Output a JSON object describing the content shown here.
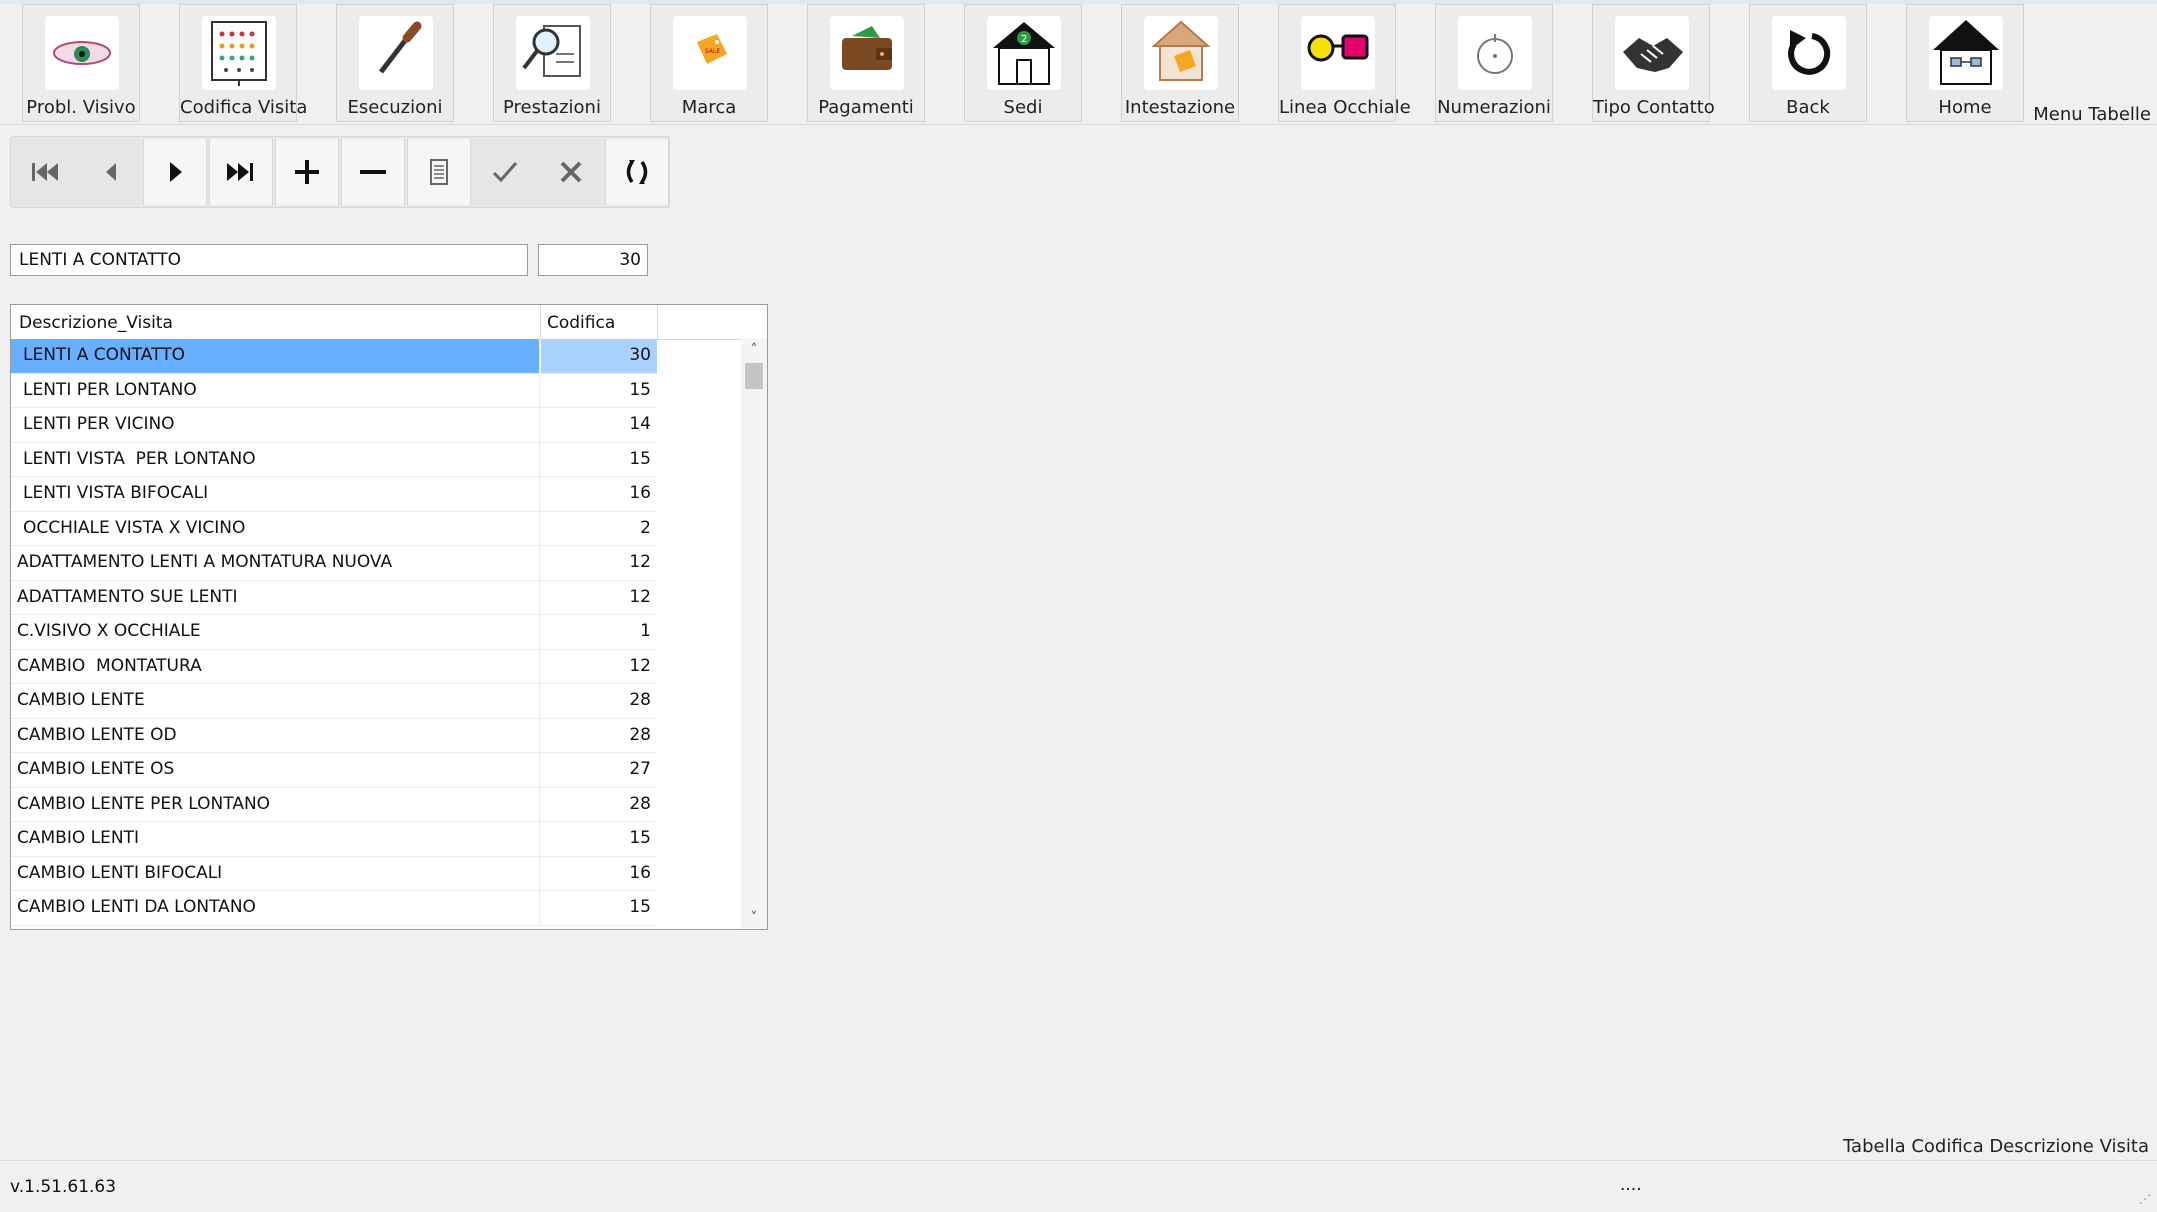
{
  "toolbar": {
    "buttons": [
      {
        "label": "Probl. Visivo",
        "icon": "eye-icon"
      },
      {
        "label": "Codifica Visita",
        "icon": "eye-chart-icon"
      },
      {
        "label": "Esecuzioni",
        "icon": "screwdriver-icon"
      },
      {
        "label": "Prestazioni",
        "icon": "magnifier-document-icon"
      },
      {
        "label": "Marca",
        "icon": "price-tag-icon"
      },
      {
        "label": "Pagamenti",
        "icon": "wallet-icon"
      },
      {
        "label": "Sedi",
        "icon": "house-number-icon"
      },
      {
        "label": "Intestazione",
        "icon": "house-tag-icon"
      },
      {
        "label": "Linea Occhiale",
        "icon": "glasses-icon"
      },
      {
        "label": "Numerazioni",
        "icon": "numbering-icon"
      },
      {
        "label": "Tipo Contatto",
        "icon": "handshake-icon"
      },
      {
        "label": "Back",
        "icon": "back-arrow-icon"
      },
      {
        "label": "Home",
        "icon": "home-icon"
      }
    ],
    "menu_label": "Menu Tabelle"
  },
  "navigator": {
    "buttons": [
      "first-record",
      "previous-record",
      "next-record",
      "last-record",
      "add-record",
      "delete-record",
      "edit-record",
      "confirm",
      "cancel",
      "refresh"
    ]
  },
  "form": {
    "descrizione": "LENTI A CONTATTO",
    "codifica": "30"
  },
  "grid": {
    "columns": [
      "Descrizione_Visita",
      "Codifica"
    ],
    "rows": [
      {
        "desc": "LENTI A CONTATTO",
        "code": "30",
        "selected": true,
        "indent": true
      },
      {
        "desc": "LENTI PER LONTANO",
        "code": "15",
        "indent": true
      },
      {
        "desc": "LENTI PER VICINO",
        "code": "14",
        "indent": true
      },
      {
        "desc": "LENTI VISTA  PER LONTANO",
        "code": "15",
        "indent": true
      },
      {
        "desc": "LENTI VISTA BIFOCALI",
        "code": "16",
        "indent": true
      },
      {
        "desc": "OCCHIALE VISTA X VICINO",
        "code": "2",
        "indent": true
      },
      {
        "desc": "ADATTAMENTO LENTI A MONTATURA NUOVA",
        "code": "12"
      },
      {
        "desc": "ADATTAMENTO SUE LENTI",
        "code": "12"
      },
      {
        "desc": "C.VISIVO X OCCHIALE",
        "code": "1"
      },
      {
        "desc": "CAMBIO  MONTATURA",
        "code": "12"
      },
      {
        "desc": "CAMBIO LENTE",
        "code": "28"
      },
      {
        "desc": "CAMBIO LENTE OD",
        "code": "28"
      },
      {
        "desc": "CAMBIO LENTE OS",
        "code": "27"
      },
      {
        "desc": "CAMBIO LENTE PER LONTANO",
        "code": "28"
      },
      {
        "desc": "CAMBIO LENTI",
        "code": "15"
      },
      {
        "desc": "CAMBIO LENTI BIFOCALI",
        "code": "16"
      },
      {
        "desc": "CAMBIO LENTI DA LONTANO",
        "code": "15"
      }
    ]
  },
  "footer": {
    "title": "Tabella Codifica Descrizione Visita",
    "version": "v.1.51.61.63",
    "status": "...."
  },
  "colors": {
    "selected_row": "#66b0ff",
    "selected_code": "#a9d2ff"
  }
}
